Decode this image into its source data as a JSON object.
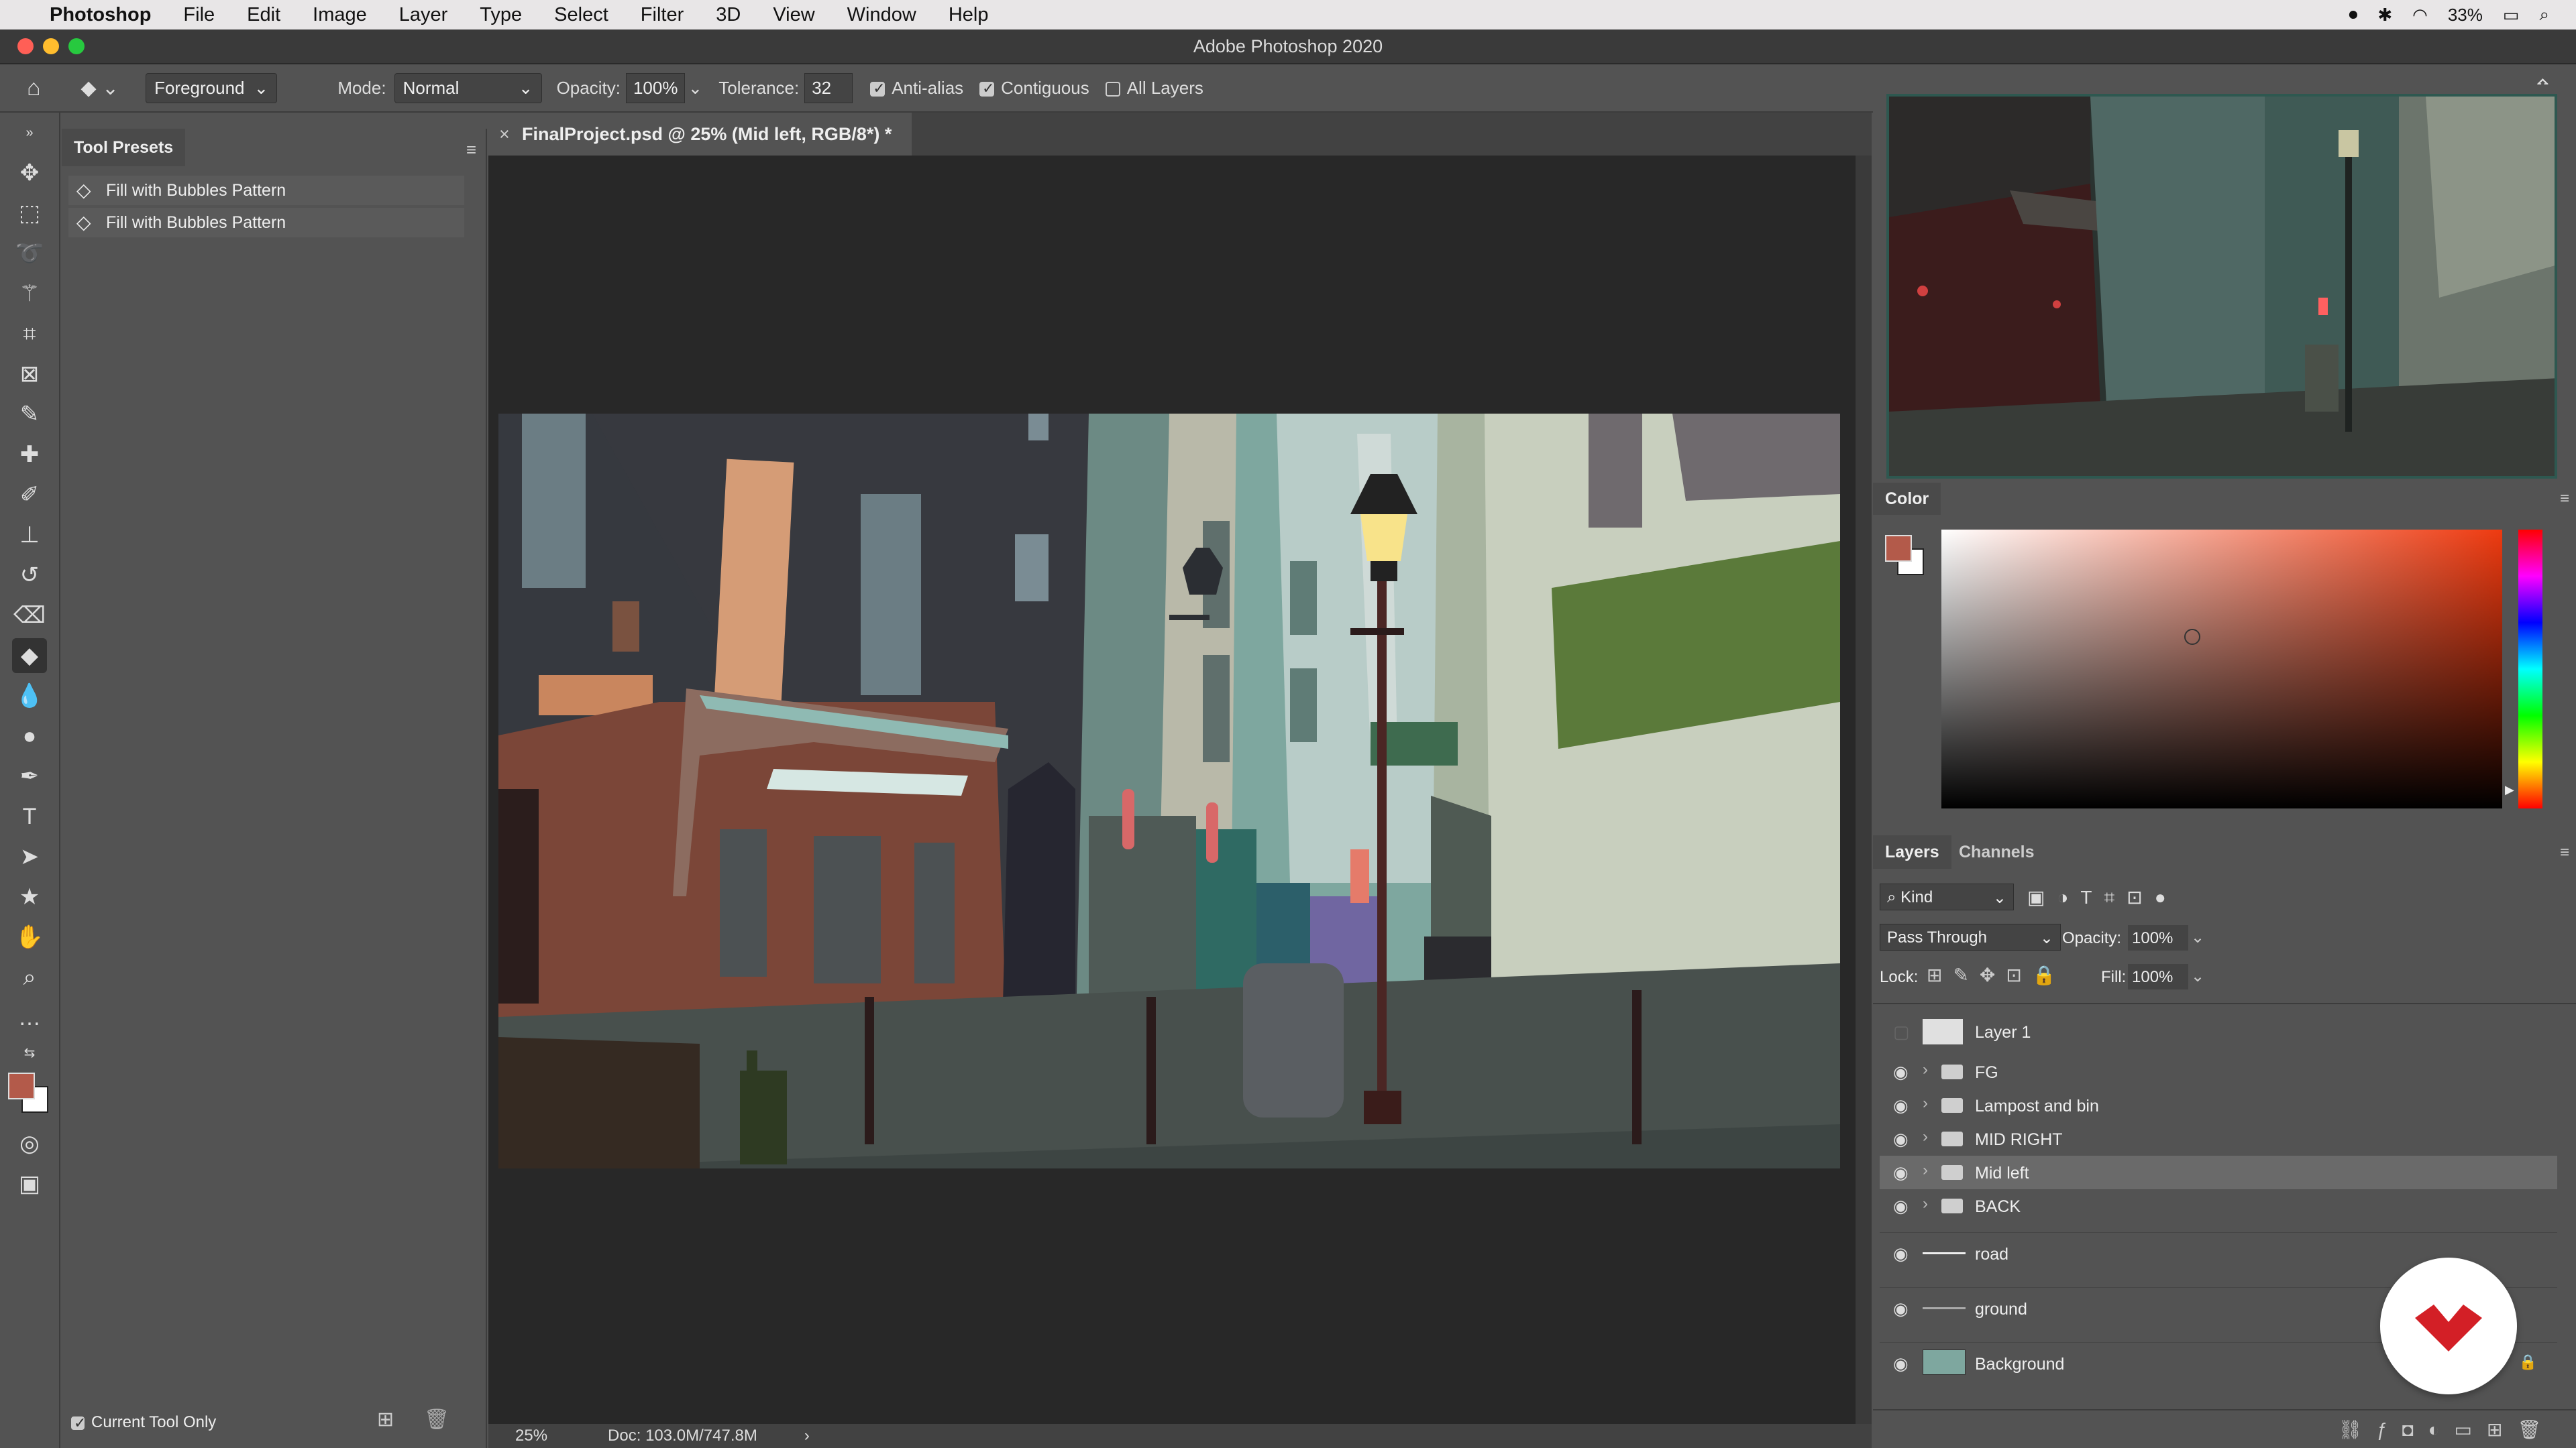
{
  "menubar": {
    "app": "Photoshop",
    "items": [
      "File",
      "Edit",
      "Image",
      "Layer",
      "Type",
      "Select",
      "Filter",
      "3D",
      "View",
      "Window",
      "Help"
    ],
    "battery": "33%"
  },
  "window": {
    "title": "Adobe Photoshop 2020"
  },
  "options": {
    "fill_source": "Foreground",
    "mode_label": "Mode:",
    "mode_value": "Normal",
    "opacity_label": "Opacity:",
    "opacity_value": "100%",
    "tolerance_label": "Tolerance:",
    "tolerance_value": "32",
    "anti_alias": "Anti-alias",
    "contiguous": "Contiguous",
    "all_layers": "All Layers"
  },
  "tool_presets": {
    "tab": "Tool Presets",
    "items": [
      "Fill with Bubbles Pattern",
      "Fill with Bubbles Pattern"
    ],
    "current_tool_only": "Current Tool Only"
  },
  "document": {
    "tab": "FinalProject.psd @ 25% (Mid left, RGB/8*) *",
    "zoom": "25%",
    "doc_size": "Doc: 103.0M/747.8M"
  },
  "color_panel": {
    "tab": "Color",
    "fg": "#b35a4a",
    "bg": "#ffffff"
  },
  "layers_panel": {
    "tabs": [
      "Layers",
      "Channels"
    ],
    "filter_kind": "Kind",
    "blend_mode": "Pass Through",
    "opacity_label": "Opacity:",
    "opacity_value": "100%",
    "lock_label": "Lock:",
    "fill_label": "Fill:",
    "fill_value": "100%",
    "layers": [
      {
        "name": "Layer 1",
        "visible": false,
        "type": "layer"
      },
      {
        "name": "FG",
        "visible": true,
        "type": "group"
      },
      {
        "name": "Lampost and bin",
        "visible": true,
        "type": "group"
      },
      {
        "name": "MID RIGHT",
        "visible": true,
        "type": "group"
      },
      {
        "name": "Mid left",
        "visible": true,
        "type": "group",
        "selected": true
      },
      {
        "name": "BACK",
        "visible": true,
        "type": "group"
      },
      {
        "name": "road",
        "visible": true,
        "type": "layer"
      },
      {
        "name": "ground",
        "visible": true,
        "type": "layer"
      },
      {
        "name": "Background",
        "visible": true,
        "type": "layer",
        "locked": true
      }
    ]
  }
}
